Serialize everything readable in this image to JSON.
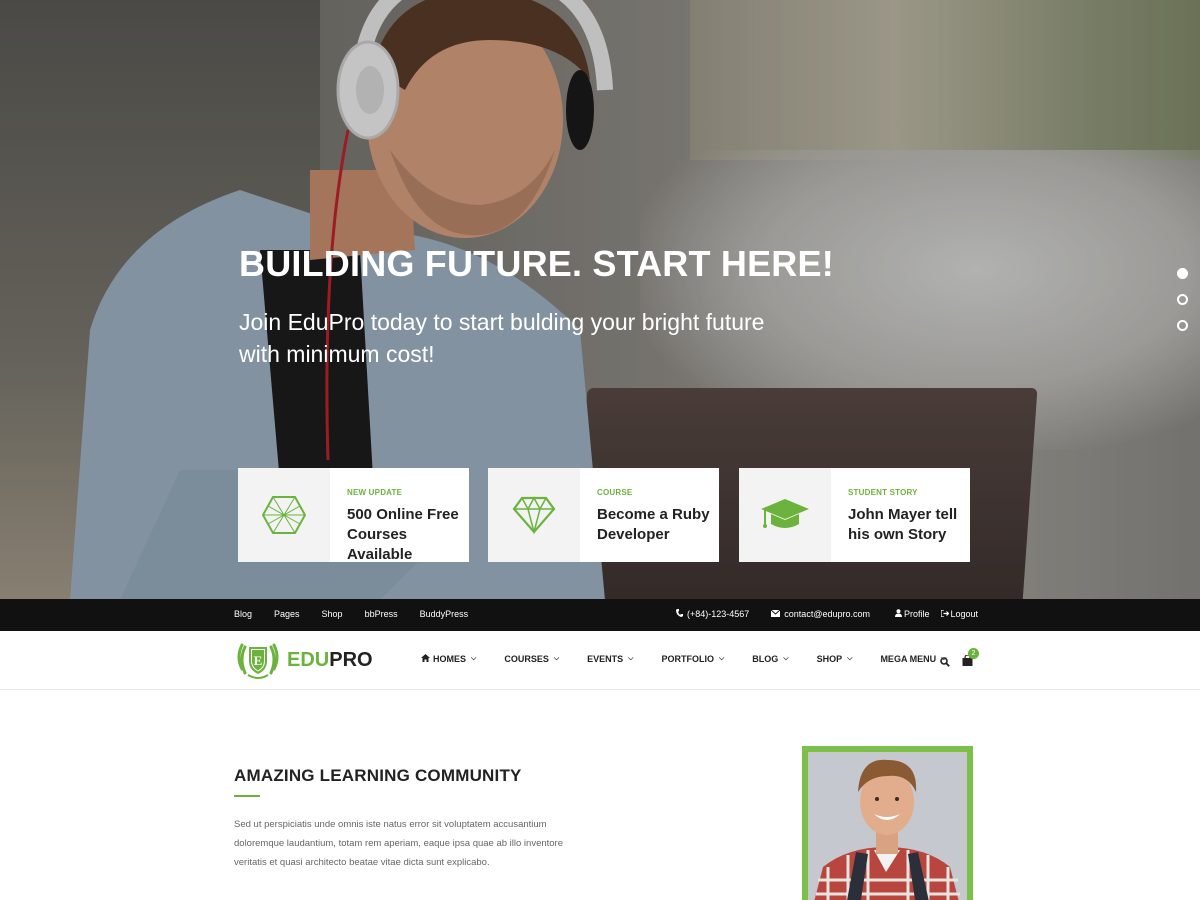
{
  "hero": {
    "title": "BUILDING FUTURE. START HERE!",
    "subtitle": "Join EduPro today to start bulding your bright future with minimum cost!",
    "slides": 3,
    "active_slide": 1
  },
  "cards": [
    {
      "tag": "NEW UPDATE",
      "title": "500 Online Free Courses Available",
      "icon": "hexagon-icon"
    },
    {
      "tag": "COURSE",
      "title": "Become a Ruby Developer",
      "icon": "diamond-icon"
    },
    {
      "tag": "STUDENT STORY",
      "title": "John Mayer tell his own Story",
      "icon": "graduation-cap-icon"
    }
  ],
  "topbar": {
    "links": [
      "Blog",
      "Pages",
      "Shop",
      "bbPress",
      "BuddyPress"
    ],
    "phone": "(+84)-123-4567",
    "email": "contact@edupro.com",
    "profile": "Profile",
    "logout": "Logout"
  },
  "logo": {
    "edu": "EDU",
    "pro": "PRO",
    "emblem": "E"
  },
  "nav": {
    "items": [
      "HOMES",
      "COURSES",
      "EVENTS",
      "PORTFOLIO",
      "BLOG",
      "SHOP",
      "MEGA MENU"
    ],
    "cart_count": "2"
  },
  "about": {
    "title": "AMAZING LEARNING COMMUNITY",
    "text": "Sed ut perspiciatis unde omnis iste natus error sit voluptatem accusantium doloremque laudantium, totam rem aperiam, eaque ipsa quae ab illo inventore veritatis et quasi architecto beatae vitae dicta sunt explicabo."
  },
  "colors": {
    "accent": "#6cb33e",
    "topbar": "#111111"
  }
}
